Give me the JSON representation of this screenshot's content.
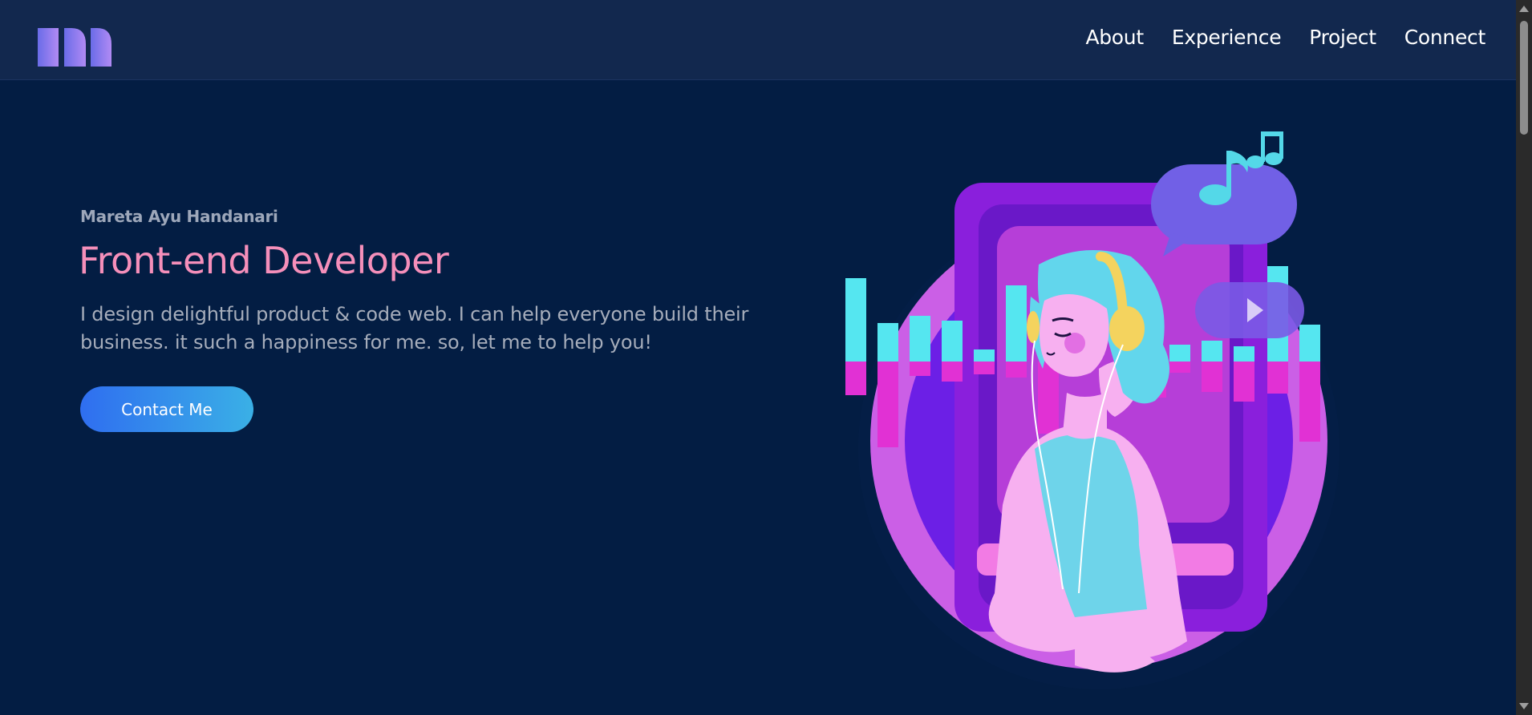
{
  "navbar": {
    "logo_icon": "m-logo-icon",
    "items": [
      {
        "label": "About"
      },
      {
        "label": "Experience"
      },
      {
        "label": "Project"
      },
      {
        "label": "Connect"
      }
    ]
  },
  "hero": {
    "name": "Mareta Ayu Handanari",
    "title": "Front-end Developer",
    "description": "I design delightful product & code web. I can help everyone build their business. it such a happiness for me. so, let me to help you!",
    "cta_label": "Contact Me"
  },
  "illustration": {
    "icon": "girl-with-headphones-illustration"
  },
  "colors": {
    "background": "#031d43",
    "navbar": "#12284e",
    "accent_pink": "#f58fba",
    "button_start": "#2f6ef0",
    "button_end": "#3ab0e6"
  }
}
